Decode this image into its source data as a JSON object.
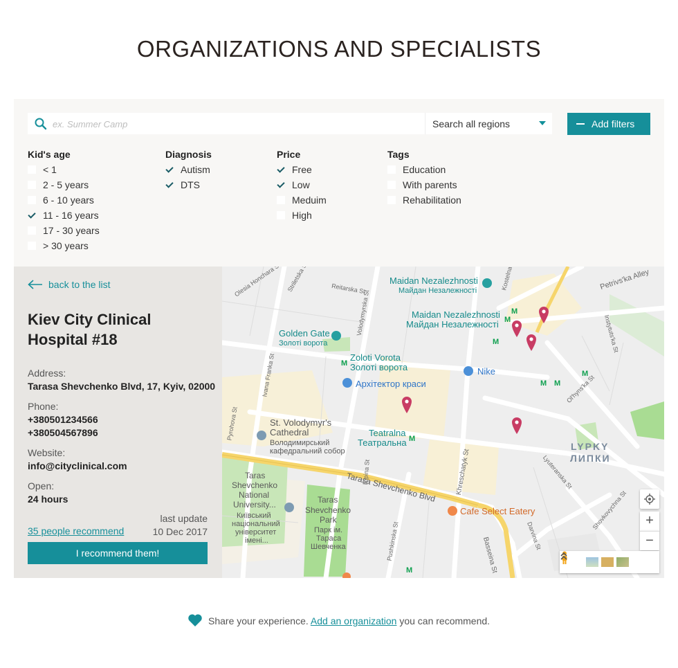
{
  "page": {
    "title": "ORGANIZATIONS AND SPECIALISTS"
  },
  "search": {
    "placeholder": "ex. Summer Camp",
    "region": "Search all regions",
    "add_filters_label": "Add filters"
  },
  "filters": {
    "kids_age": {
      "title": "Kid's age",
      "options": [
        {
          "label": "< 1",
          "checked": false
        },
        {
          "label": "2 - 5 years",
          "checked": false
        },
        {
          "label": "6 - 10 years",
          "checked": false
        },
        {
          "label": "11 - 16 years",
          "checked": true
        },
        {
          "label": "17 - 30 years",
          "checked": false
        },
        {
          "label": "> 30 years",
          "checked": false
        }
      ]
    },
    "diagnosis": {
      "title": "Diagnosis",
      "options": [
        {
          "label": "Autism",
          "checked": true
        },
        {
          "label": "DTS",
          "checked": true
        }
      ]
    },
    "price": {
      "title": "Price",
      "options": [
        {
          "label": "Free",
          "checked": true
        },
        {
          "label": "Low",
          "checked": true
        },
        {
          "label": "Meduim",
          "checked": false
        },
        {
          "label": "High",
          "checked": false
        }
      ]
    },
    "tags": {
      "title": "Tags",
      "options": [
        {
          "label": "Education",
          "checked": false
        },
        {
          "label": "With parents",
          "checked": false
        },
        {
          "label": "Rehabilitation",
          "checked": false
        }
      ]
    }
  },
  "details": {
    "back_label": "back to the list",
    "name": "Kiev City Clinical Hospital #18",
    "address_label": "Address:",
    "address": "Tarasa Shevchenko Blvd, 17, Kyiv, 02000",
    "phone_label": "Phone:",
    "phones": [
      "+380501234566",
      "+380504567896"
    ],
    "website_label": "Website:",
    "website": "info@cityclinical.com",
    "open_label": "Open:",
    "open": "24 hours",
    "last_update_label": "last update",
    "last_update": "10 Dec 2017",
    "recommend_count": "35 people recommend",
    "recommend_button": "I recommend them!"
  },
  "map": {
    "labels": {
      "maidan_en": "Maidan Nezalezhnosti",
      "maidan_ua": "Майдан Незалежності",
      "maidan2_en": "Maidan Nezalezhnosti",
      "maidan2_ua": "Майдан Незалежності",
      "golden_gate_en": "Golden Gate",
      "golden_gate_ua": "Золоті ворота",
      "zoloti_en": "Zoloti Vorota",
      "zoloti_ua": "Золоті ворота",
      "nike": "Nike",
      "arkhitektor": "Архітектор краси",
      "cathedral_en_1": "St. Volodymyr's",
      "cathedral_en_2": "Cathedral",
      "cathedral_ua_1": "Володимирський",
      "cathedral_ua_2": "кафедральний собор",
      "teatralna_en": "Teatralna",
      "teatralna_ua": "Театральна",
      "lypky_en": "LYPKY",
      "lypky_ua": "ЛИПКИ",
      "university_1": "Taras",
      "university_2": "Shevchenko",
      "university_3": "National",
      "university_4": "University...",
      "university_5": "Київський",
      "university_6": "національний",
      "university_7": "університет",
      "university_8": "імені...",
      "park_1": "Taras",
      "park_2": "Shevchenko",
      "park_3": "Park",
      "park_4": "Парк ім.",
      "park_5": "Тараса",
      "park_6": "Шевченка",
      "cafe": "Cafe Select Eatery",
      "blvd": "Tarasa Shevchenko Blvd",
      "petrivska": "Petrivs'ka Alley",
      "volodymyrska": "Volodymyrska St",
      "khreschatyk": "Khreschatyk St",
      "basseina": "Basseina St",
      "lyuteranska": "Lyuteranska St",
      "shovkovychna": "Shovkovychna St",
      "olhynska": "Ol'hyns'ka St",
      "instytutska": "Instytuts'ka St",
      "darwina": "Darvina St",
      "pushkinska": "Pushkinska St",
      "ripina": "Ripina St",
      "ivana_franka": "Ivana Franka St",
      "pyrohova": "Pyrohova St",
      "reitarska": "Reitarska St",
      "streletska": "Striletska St",
      "honchara": "Olesia Honchara St",
      "kostelna": "Kostelna St"
    },
    "zoom_in": "+",
    "zoom_out": "−"
  },
  "footer": {
    "prefix": "Share your experience.",
    "link": "Add an organization",
    "suffix": "you can recommend."
  },
  "colors": {
    "accent": "#168f9a",
    "pin": "#c83c64",
    "metro": "#10a050"
  }
}
